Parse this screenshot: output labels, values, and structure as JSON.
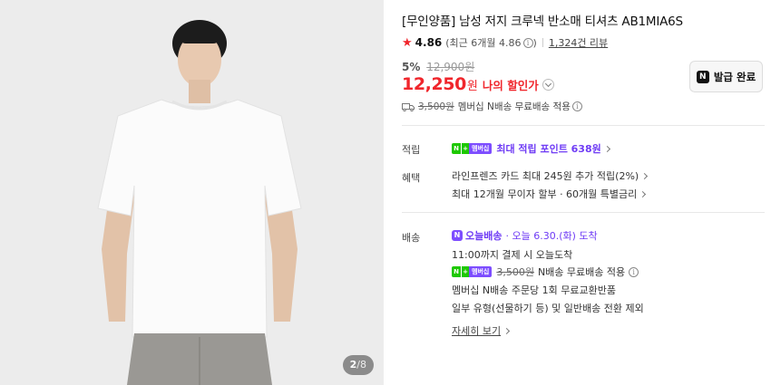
{
  "gallery": {
    "current": "2",
    "total": "/8"
  },
  "product": {
    "title": "[무인양품] 남성 저지 크루넥 반소매 티셔츠 AB1MIA6S",
    "rating": "4.86",
    "rating_recent": "(최근 6개월 4.86",
    "rating_recent_close": ")",
    "review_count": "1,324건 리뷰",
    "discount_rate": "5%",
    "original_price": "12,900원",
    "sale_price": "12,250",
    "currency": "원",
    "my_discount_label": "나의 할인가"
  },
  "coupon": {
    "badge": "N",
    "label": "발급 완료"
  },
  "shipping_note": {
    "strike": "3,500원",
    "text": "멤버십 N배송 무료배송 적용"
  },
  "points": {
    "label": "적립",
    "badge_n": "N",
    "badge_plus": "+",
    "badge_text": "멤버십",
    "text": "최대 적립 포인트 638원"
  },
  "benefits": {
    "label": "혜택",
    "line1": "라인프렌즈 카드 최대 245원 추가 적립(2%)",
    "line2": "최대 12개월 무이자 할부 · 60개월 특별금리"
  },
  "delivery": {
    "label": "배송",
    "today_icon": "N",
    "today_label": "오늘배송",
    "date_text": "· 오늘 6.30.(화) 도착",
    "deadline": "11:00까지 결제 시 오늘도착",
    "badge_n": "N",
    "badge_plus": "+",
    "badge_text": "멤버십",
    "member_strike": "3,500원",
    "member_text": "N배송 무료배송 적용",
    "exchange": "멤버십 N배송 주문당 1회 무료교환반품",
    "exclusion": "일부 유형(선물하기 등) 및 일반배송 전환 제외",
    "detail_link": "자세히 보기"
  },
  "colors": {
    "accent_red": "#f0262c",
    "purple": "#6f3cf5",
    "naver_green": "#1ec800"
  }
}
